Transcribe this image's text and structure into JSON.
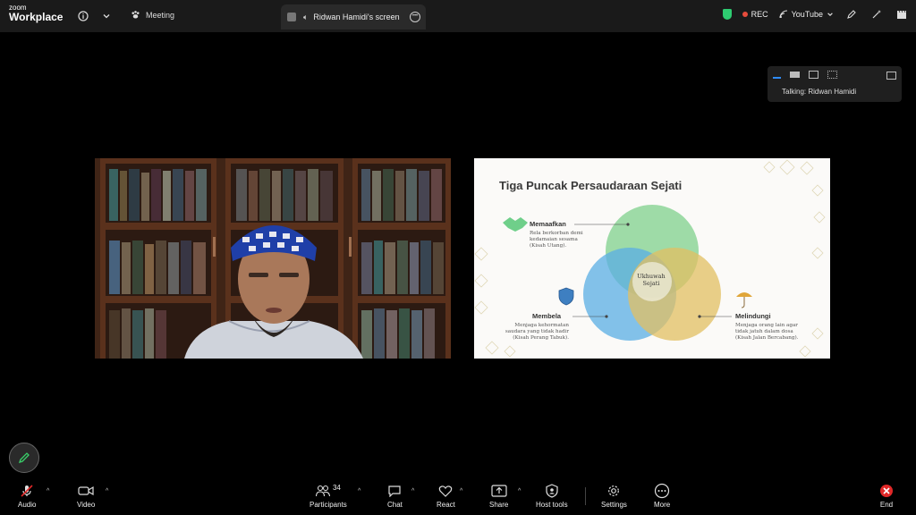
{
  "app": {
    "brand_small": "zoom",
    "brand_name": "Workplace"
  },
  "topbar": {
    "meeting_label": "Meeting",
    "screen_tab_label": "Ridwan Hamidi's screen",
    "rec_label": "REC",
    "youtube_label": "YouTube"
  },
  "view_panel": {
    "talking": "Talking: Ridwan Hamidi"
  },
  "slide": {
    "title": "Tiga Puncak Persaudaraan Sejati",
    "center": [
      "Ukhuwah",
      "Sejati"
    ],
    "items": [
      {
        "label": "Memaafkan",
        "desc": [
          "Rela berkorban demi",
          "kedamaian sesama",
          "(Kisah Utang)."
        ]
      },
      {
        "label": "Membela",
        "desc": [
          "Menjaga kehormatan",
          "saudara yang tidak hadir",
          "(Kisah Perang Tabuk)."
        ]
      },
      {
        "label": "Melindungi",
        "desc": [
          "Menjaga orang lain agar",
          "tidak jatuh dalam dosa",
          "(Kisah Jalan Bercabang)."
        ]
      }
    ]
  },
  "toolbar": {
    "audio": "Audio",
    "video": "Video",
    "participants": "Participants",
    "participants_count": "34",
    "chat": "Chat",
    "react": "React",
    "share": "Share",
    "host_tools": "Host tools",
    "settings": "Settings",
    "more": "More",
    "end": "End"
  },
  "colors": {
    "accent_blue": "#2e8cff",
    "rec_red": "#e74c3c",
    "secure_green": "#2ecc71",
    "end_red": "#e02828",
    "circle_green": "#7fd08c",
    "circle_blue": "#5aaee4",
    "circle_gold": "#e2bf62"
  }
}
